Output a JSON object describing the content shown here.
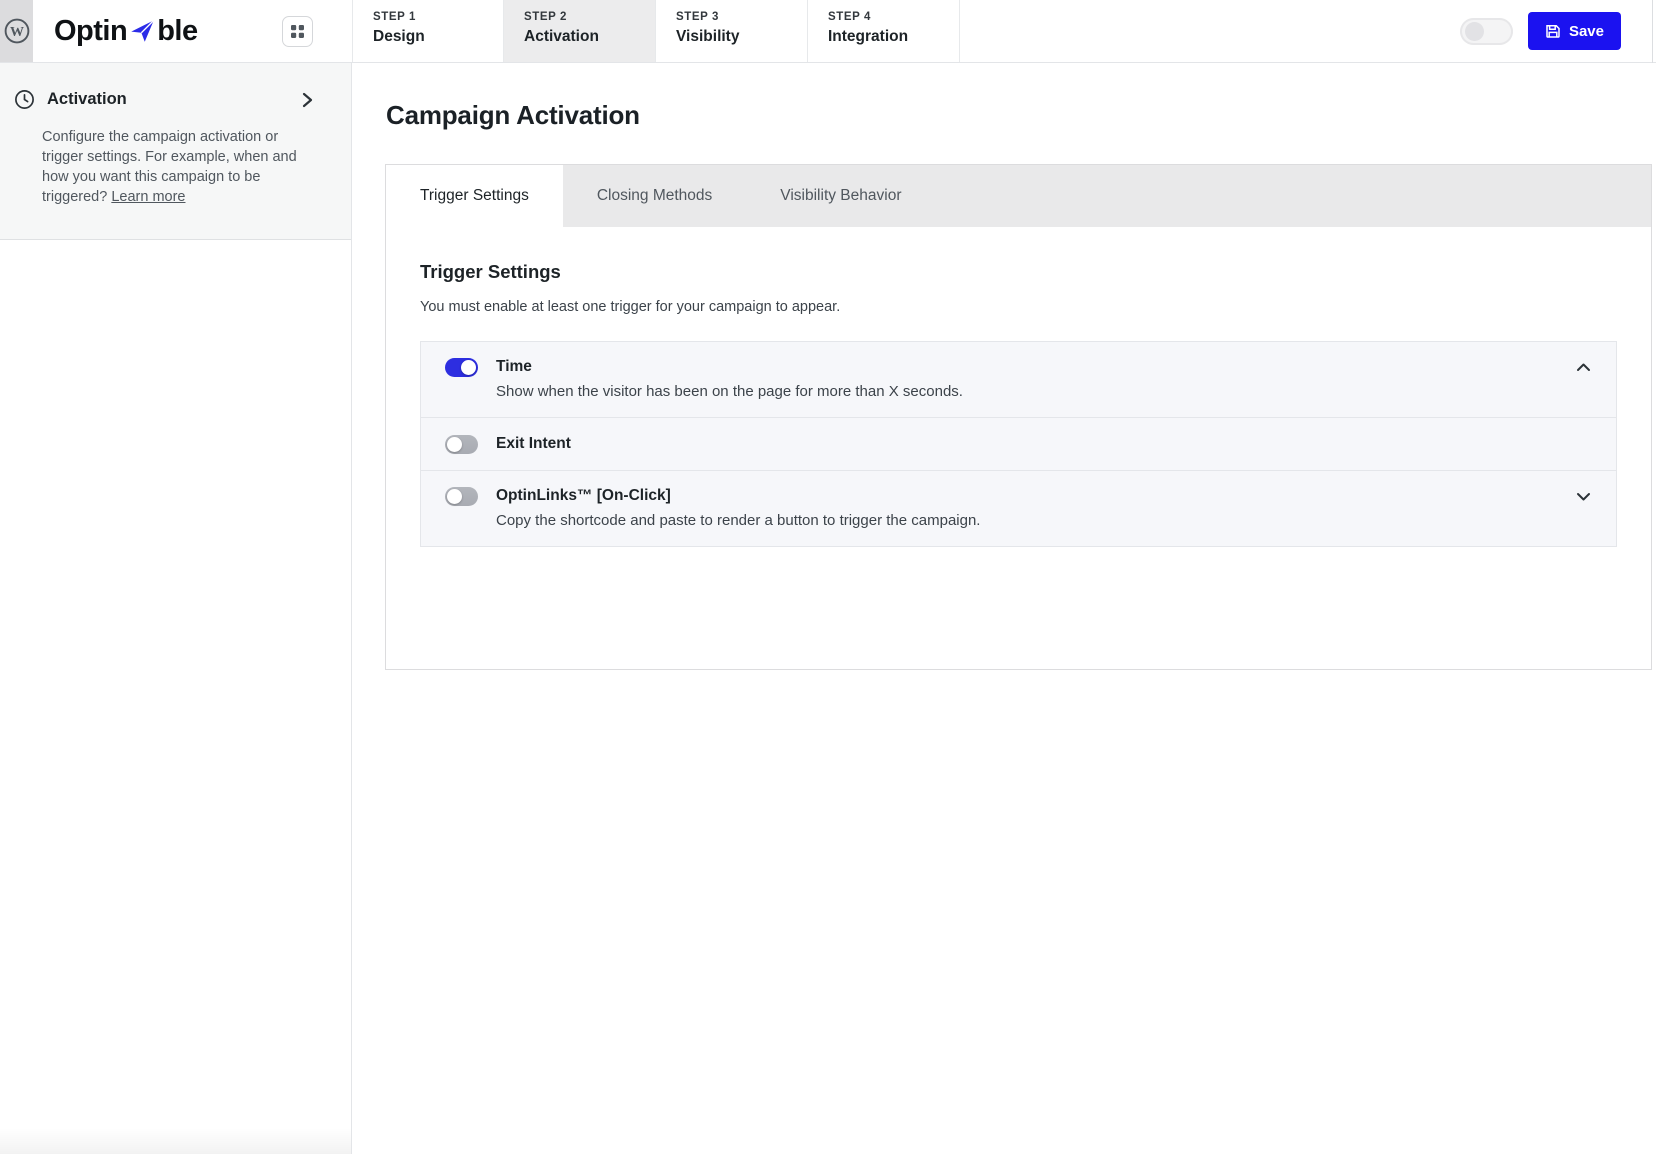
{
  "header": {
    "logo_prefix": "Optin",
    "logo_suffix": "ble",
    "steps": [
      {
        "eyebrow": "STEP 1",
        "label": "Design",
        "active": false
      },
      {
        "eyebrow": "STEP 2",
        "label": "Activation",
        "active": true
      },
      {
        "eyebrow": "STEP 3",
        "label": "Visibility",
        "active": false
      },
      {
        "eyebrow": "STEP 4",
        "label": "Integration",
        "active": false
      }
    ],
    "autosave_toggle_on": false,
    "save_label": "Save"
  },
  "sidebar": {
    "title": "Activation",
    "description": "Configure the campaign activation or trigger settings. For example, when and how you want this campaign to be triggered? ",
    "learn_more_label": "Learn more"
  },
  "main": {
    "page_title": "Campaign Activation",
    "tabs": [
      {
        "label": "Trigger Settings",
        "active": true
      },
      {
        "label": "Closing Methods",
        "active": false
      },
      {
        "label": "Visibility Behavior",
        "active": false
      }
    ],
    "section_title": "Trigger Settings",
    "section_subtitle": "You must enable at least one trigger for your campaign to appear.",
    "triggers": [
      {
        "label": "Time",
        "description": "Show when the visitor has been on the page for more than X seconds.",
        "enabled": true,
        "expanded": true
      },
      {
        "label": "Exit Intent",
        "description": "",
        "enabled": false
      },
      {
        "label": "OptinLinks™ [On-Click]",
        "description": "Copy the shortcode and paste to render a button to trigger the campaign.",
        "enabled": false,
        "expanded": false
      }
    ]
  },
  "colors": {
    "accent_blue": "#1b12f0",
    "toggle_on_blue": "#2d2ee0",
    "active_step_bg": "#ececed",
    "tab_strip_bg": "#e9e9ea",
    "row_bg": "#f6f7fa",
    "sidebar_panel_bg": "#f6f7f7"
  }
}
